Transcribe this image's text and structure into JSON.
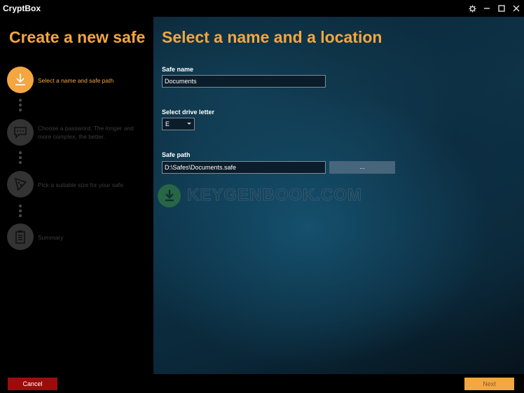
{
  "app": {
    "title": "CryptBox"
  },
  "titlebar": {
    "settings_icon": "gear-icon",
    "minimize_icon": "minimize-icon",
    "maximize_icon": "maximize-icon",
    "close_icon": "close-icon"
  },
  "sidebar": {
    "title": "Create a new safe",
    "steps": [
      {
        "label": "Select a name and safe path",
        "icon": "download-icon",
        "active": true
      },
      {
        "label": "Choose a password. The longer and more complex, the better.",
        "icon": "chat-bubble-icon",
        "active": false
      },
      {
        "label": "Pick a suitable size for your safe.",
        "icon": "pizza-slice-icon",
        "active": false
      },
      {
        "label": "Summary",
        "icon": "clipboard-icon",
        "active": false
      }
    ]
  },
  "main": {
    "title": "Select a name and a location",
    "safe_name": {
      "label": "Safe name",
      "value": "Documents"
    },
    "drive_letter": {
      "label": "Select drive letter",
      "value": "E"
    },
    "safe_path": {
      "label": "Safe path",
      "value": "D:\\Safes\\Documents.safe",
      "browse_label": "..."
    }
  },
  "watermark": {
    "text": "KEYGENBOOK.COM"
  },
  "footer": {
    "cancel_label": "Cancel",
    "next_label": "Next"
  },
  "colors": {
    "accent": "#f4a640",
    "cancel": "#9b0c0c",
    "browse": "#47657b",
    "inactive_step": "#333333"
  }
}
